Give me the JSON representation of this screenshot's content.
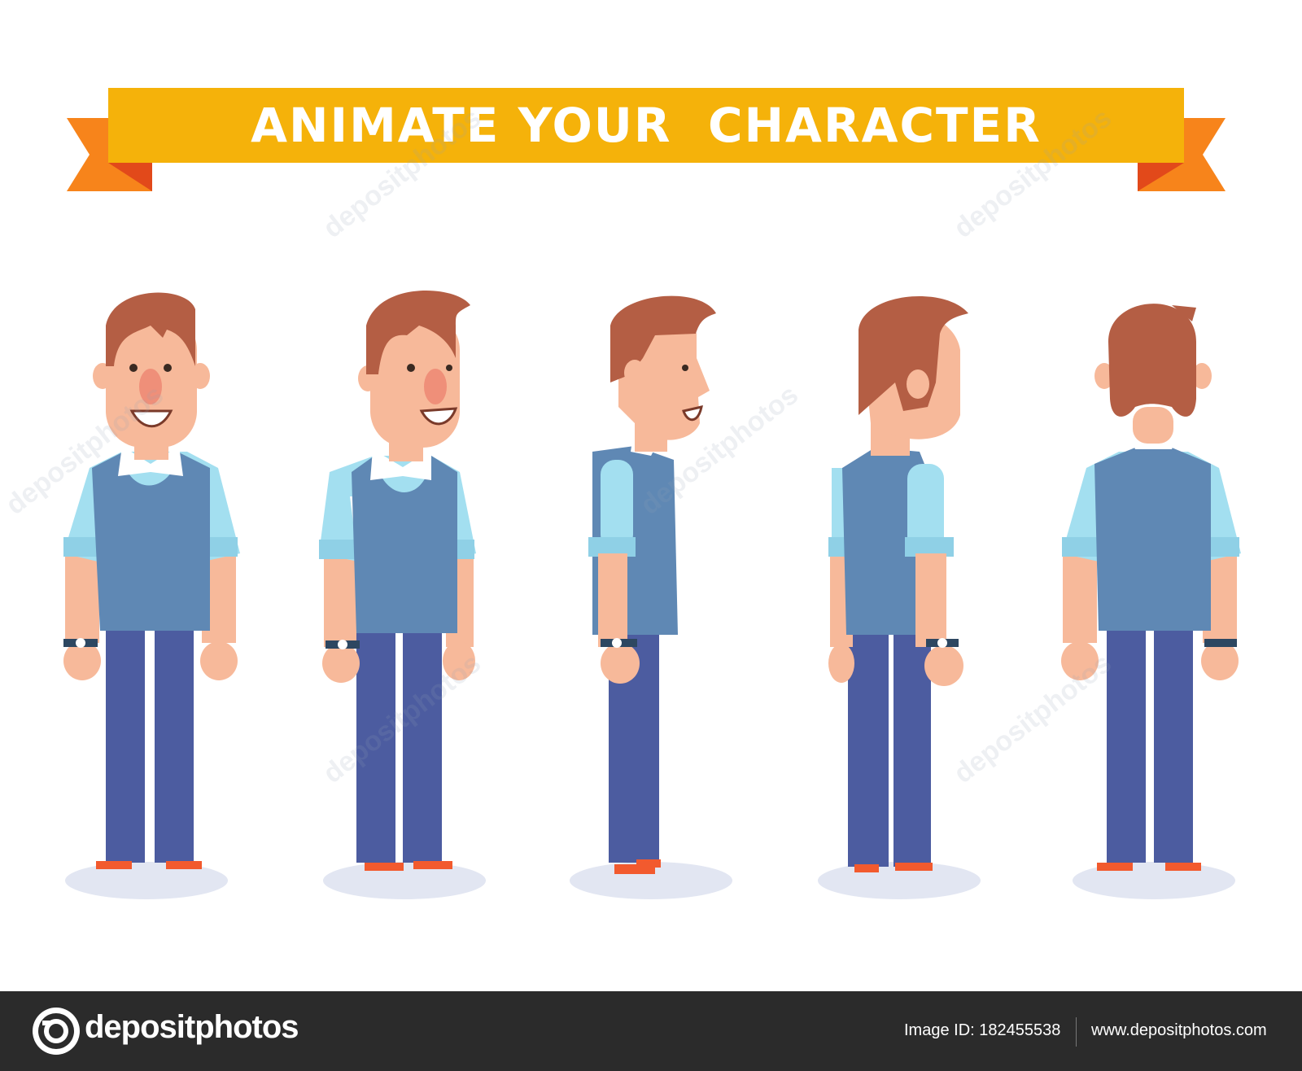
{
  "banner": {
    "title": "ANIMATE YOUR  CHARACTER",
    "colors": {
      "band": "#f5b20a",
      "tail": "#f7841b",
      "fold": "#e2491a"
    }
  },
  "figures": [
    {
      "name": "front-view"
    },
    {
      "name": "three-quarter-front-view"
    },
    {
      "name": "side-view"
    },
    {
      "name": "three-quarter-back-view"
    },
    {
      "name": "back-view"
    }
  ],
  "palette": {
    "hair": "#b45e44",
    "skin": "#f7b99a",
    "nose": "#ef8f79",
    "shirt": "#a3dff0",
    "vest": "#5f88b4",
    "pants": "#4c5ca0",
    "shoe": "#f25a2e",
    "shadow": "#e2e6f2",
    "watch": "#2d4761"
  },
  "watermark": {
    "text": "depositphotos"
  },
  "footer": {
    "brand": "depositphotos",
    "image_id": "Image ID: 182455538",
    "site": "www.depositphotos.com",
    "background": "#2b2b2b"
  }
}
